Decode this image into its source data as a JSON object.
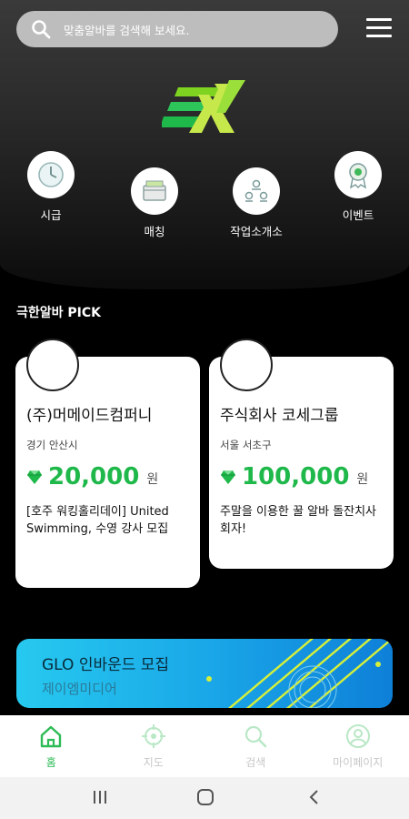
{
  "search": {
    "placeholder": "맞춤알바를 검색해 보세요."
  },
  "categories": [
    {
      "label": "시급",
      "icon": "clock-icon"
    },
    {
      "label": "매칭",
      "icon": "wallet-icon"
    },
    {
      "label": "작업소개소",
      "icon": "people-icon"
    },
    {
      "label": "이벤트",
      "icon": "medal-icon"
    }
  ],
  "section": {
    "title": "극한알바 PICK"
  },
  "cards": [
    {
      "company": "(주)머메이드컴퍼니",
      "location": "경기 안산시",
      "amount": "20,000",
      "unit": "원",
      "desc": "[호주 워킹홀리데이] United Swimming, 수영 강사 모집"
    },
    {
      "company": "주식회사 코세그룹",
      "location": "서울 서초구",
      "amount": "100,000",
      "unit": "원",
      "desc": "주말을 이용한 꿀 알바 돌잔치사회자!"
    }
  ],
  "banner": {
    "title": "GLO 인바운드 모집",
    "subtitle": "제이엠미디어"
  },
  "tabs": [
    {
      "label": "홈",
      "icon": "home-icon",
      "active": true
    },
    {
      "label": "지도",
      "icon": "map-target-icon",
      "active": false
    },
    {
      "label": "검색",
      "icon": "search-icon",
      "active": false
    },
    {
      "label": "마이페이지",
      "icon": "profile-icon",
      "active": false
    }
  ],
  "colors": {
    "accent": "#2dbb55",
    "pay": "#1fb84a",
    "banner": "#1aa8e8"
  }
}
